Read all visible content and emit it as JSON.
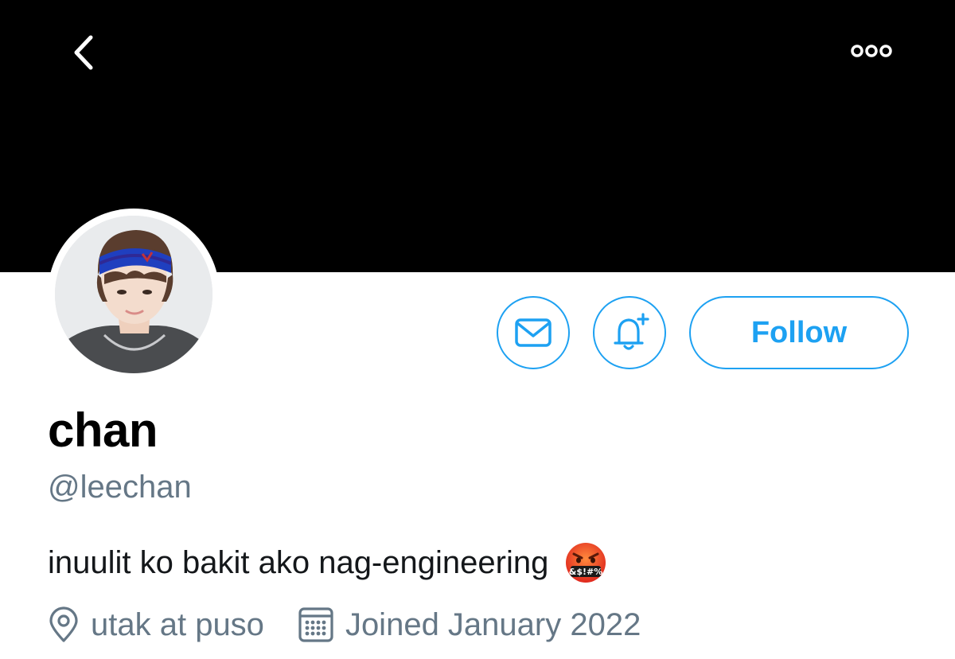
{
  "colors": {
    "accent": "#1da1f2",
    "banner": "#000000",
    "secondary_text": "#657786",
    "primary_text": "#14171a"
  },
  "header": {
    "back_icon": "chevron-left-icon",
    "more_icon": "ellipsis-horizontal-icon"
  },
  "profile": {
    "display_name": "chan",
    "handle": "@leechan",
    "bio": "inuulit ko bakit ako nag-engineering",
    "bio_emoji": "face-with-symbols-on-mouth",
    "location": "utak at puso",
    "joined": "Joined January 2022"
  },
  "actions": {
    "message_icon": "mail-icon",
    "notify_icon": "bell-plus-icon",
    "follow_label": "Follow"
  }
}
